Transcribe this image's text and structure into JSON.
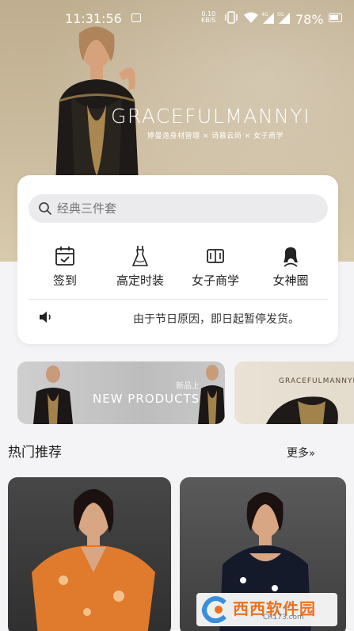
{
  "status_bar": {
    "time": "11:31:56",
    "net_speed_value": "0.10",
    "net_speed_unit": "KB/S",
    "signal_1": "4G",
    "signal_2": "5G",
    "battery": "78%"
  },
  "hero": {
    "brand": "GRACEFULMANNYI",
    "tagline": "婷曼逸身材管理 × 诗慕云尚 × 女子商学"
  },
  "search": {
    "placeholder": "经典三件套"
  },
  "quick_actions": [
    {
      "label": "签到",
      "icon": "calendar-check-icon"
    },
    {
      "label": "高定时装",
      "icon": "dress-icon"
    },
    {
      "label": "女子商学",
      "icon": "book-icon"
    },
    {
      "label": "女神圈",
      "icon": "woman-profile-icon"
    }
  ],
  "notice": {
    "text": "由于节日原因，即日起暂停发货。"
  },
  "banners": {
    "banner_1": {
      "text": "NEW PRODUCTS",
      "cn": "新品上"
    },
    "banner_2": {
      "text": "GRACEFULMANNYI"
    }
  },
  "hot": {
    "title": "热门推荐",
    "more": "更多",
    "more_chevron": "»"
  },
  "watermark": {
    "main": "西西软件园",
    "sub": "CR173.com"
  },
  "colors": {
    "hero_bg": "#c7b697",
    "accent_watermark": "#e9731f",
    "card_bg": "#ffffff",
    "page_bg": "#f4f4f6"
  }
}
